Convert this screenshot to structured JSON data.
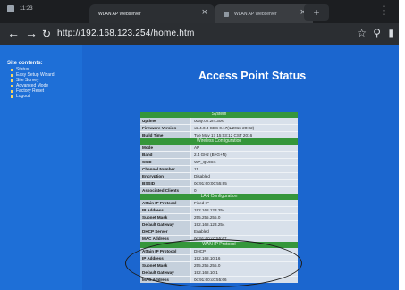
{
  "tabs": [
    {
      "label": "WLAN AP Webserver",
      "active": true
    },
    {
      "label": "WLAN AP Webserver",
      "active": false
    }
  ],
  "status_text": "11:23",
  "url": "http://192.168.123.254/home.htm",
  "sidebar": {
    "title": "Site contents:",
    "items": [
      "Status",
      "Easy Setup Wizard",
      "Site Survey",
      "Advanced Mode",
      "Factory Reset",
      "Logout"
    ]
  },
  "page_title": "Access Point Status",
  "sections": [
    {
      "title": "System",
      "rows": [
        {
          "key": "Uptime",
          "value": "0day:0h:2m:30s"
        },
        {
          "key": "Firmware Version",
          "value": "v2.4.0.3 CBS 0.17(1/2016 20:02)"
        },
        {
          "key": "Build Time",
          "value": "Tue May 17 15:03:12 CST 2016"
        }
      ]
    },
    {
      "title": "Wireless Configuration",
      "rows": [
        {
          "key": "Mode",
          "value": "AP"
        },
        {
          "key": "Band",
          "value": "2.4 GHz (B+G+N)"
        },
        {
          "key": "SSID",
          "value": "WP_QUICK"
        },
        {
          "key": "Channel Number",
          "value": "11"
        },
        {
          "key": "Encryption",
          "value": "Disabled"
        },
        {
          "key": "BSSID",
          "value": "0c:91:60:00:55:65"
        },
        {
          "key": "Associated Clients",
          "value": "0"
        }
      ]
    },
    {
      "title": "LAN Configuration",
      "rows": [
        {
          "key": "Attain IP Protocol",
          "value": "Fixed IP"
        },
        {
          "key": "IP Address",
          "value": "192.168.123.254"
        },
        {
          "key": "Subnet Mask",
          "value": "255.255.255.0"
        },
        {
          "key": "Default Gateway",
          "value": "192.168.123.254"
        },
        {
          "key": "DHCP Server",
          "value": "Enabled"
        },
        {
          "key": "MAC Address",
          "value": "0c:91:60:c0:55:67"
        }
      ]
    },
    {
      "title": "WAN IP Protocol",
      "rows": [
        {
          "key": "Attain IP Protocol",
          "value": "DHCP"
        },
        {
          "key": "IP Address",
          "value": "192.168.10.16"
        },
        {
          "key": "Subnet Mask",
          "value": "255.255.255.0"
        },
        {
          "key": "Default Gateway",
          "value": "192.168.10.1"
        },
        {
          "key": "MAC Address",
          "value": "0c:91:60:c0:55:66"
        }
      ]
    }
  ]
}
